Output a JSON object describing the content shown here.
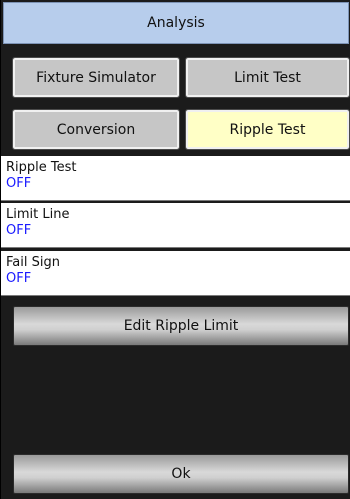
{
  "title": "Analysis",
  "buttons": {
    "fixture_simulator": "Fixture Simulator",
    "limit_test": "Limit Test",
    "conversion": "Conversion",
    "ripple_test": "Ripple Test"
  },
  "fields": [
    {
      "label": "Ripple Test",
      "value": "OFF"
    },
    {
      "label": "Limit Line",
      "value": "OFF"
    },
    {
      "label": "Fail Sign",
      "value": "OFF"
    }
  ],
  "actions": {
    "edit_ripple_limit": "Edit Ripple Limit",
    "ok": "Ok"
  },
  "colors": {
    "title_bg": "#b7cdec",
    "button_bg": "#c6c6c6",
    "active_button_bg": "#ffffc6",
    "value_text": "#1a1aff",
    "panel_bg": "#1b1b1b"
  }
}
